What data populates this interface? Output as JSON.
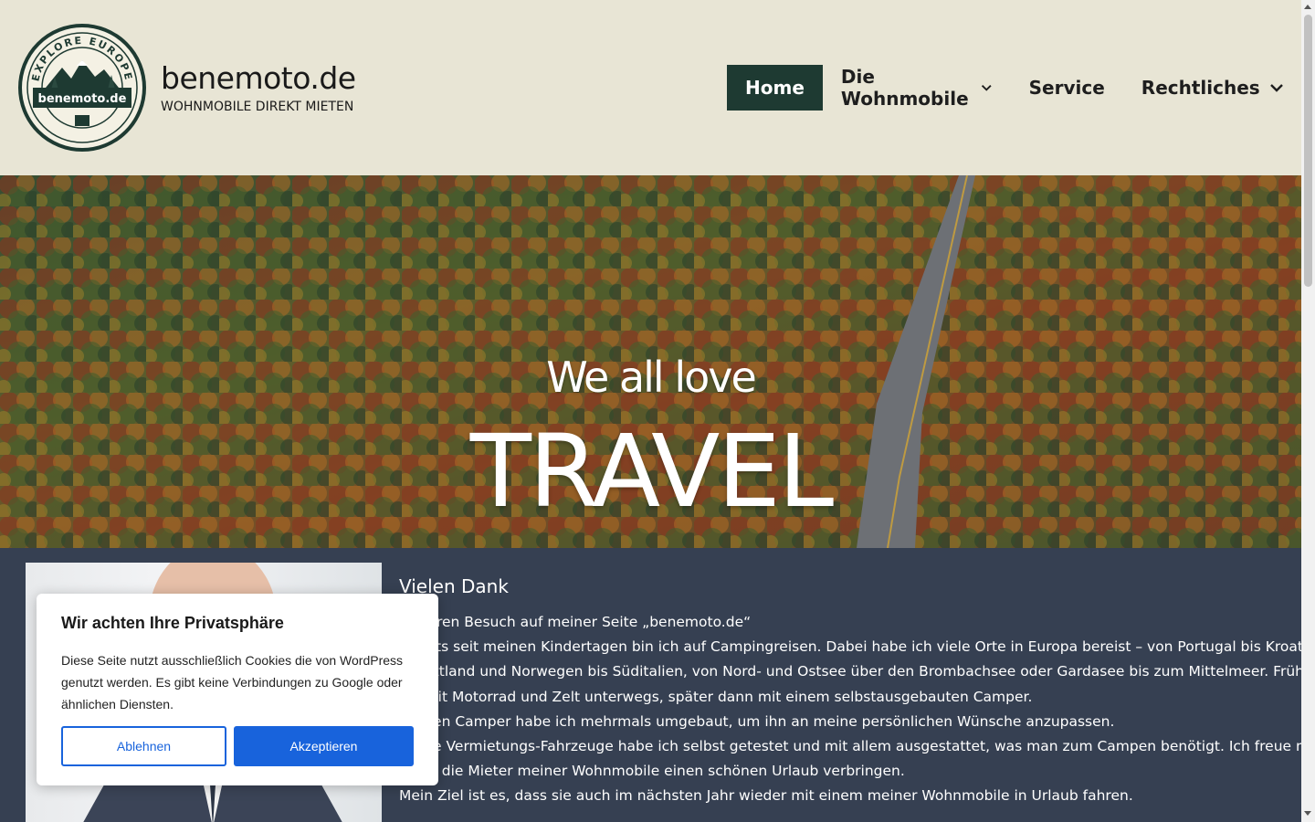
{
  "site": {
    "title": "benemoto.de",
    "tagline": "WOHNMOBILE DIREKT MIETEN",
    "logo_text_top": "EXPLORE EUROPE",
    "logo_text_band": "benemoto.de"
  },
  "nav": {
    "items": [
      {
        "label": "Home",
        "active": true
      },
      {
        "label": "Die Wohnmobile",
        "dropdown": true
      },
      {
        "label": "Service"
      },
      {
        "label": "Rechtliches",
        "dropdown": true
      }
    ]
  },
  "hero": {
    "line1": "We all love",
    "line2": "TRAVEL"
  },
  "content": {
    "heading": "Vielen Dank",
    "paragraphs": [
      "für Ihren Besuch auf meiner Seite „benemoto.de“",
      "Bereits seit meinen Kindertagen bin ich auf Campingreisen. Dabei habe ich viele Orte in Europa bereist – von Portugal bis Kroatien, von",
      "Schottland und Norwegen bis Süditalien, von Nord- und Ostsee über den Brombachsee oder Gardasee bis zum Mittelmeer. Früher war",
      "ich mit Motorrad und Zelt unterwegs, später dann mit einem selbstausgebauten Camper.",
      "Meinen Camper habe ich mehrmals umgebaut, um ihn an meine persönlichen Wünsche anzupassen.",
      "Meine Vermietungs-Fahrzeuge habe ich selbst getestet und mit allem ausgestattet, was man zum Campen benötigt. Ich freue mich,",
      "wenn die Mieter meiner Wohnmobile einen schönen Urlaub verbringen.",
      "Mein Ziel ist es, dass sie auch im nächsten Jahr wieder mit einem meiner Wohnmobile in Urlaub fahren."
    ]
  },
  "cookie": {
    "title": "Wir achten Ihre Privatsphäre",
    "text": "Diese Seite nutzt ausschließlich Cookies die von WordPress genutzt werden. Es gibt keine Verbindungen zu Google oder ähnlichen Diensten.",
    "decline_label": "Ablehnen",
    "accept_label": "Akzeptieren"
  },
  "colors": {
    "header_bg": "#e8e5d5",
    "nav_active": "#1e3a32",
    "content_bg": "#364052",
    "cookie_accent": "#1863dc"
  }
}
